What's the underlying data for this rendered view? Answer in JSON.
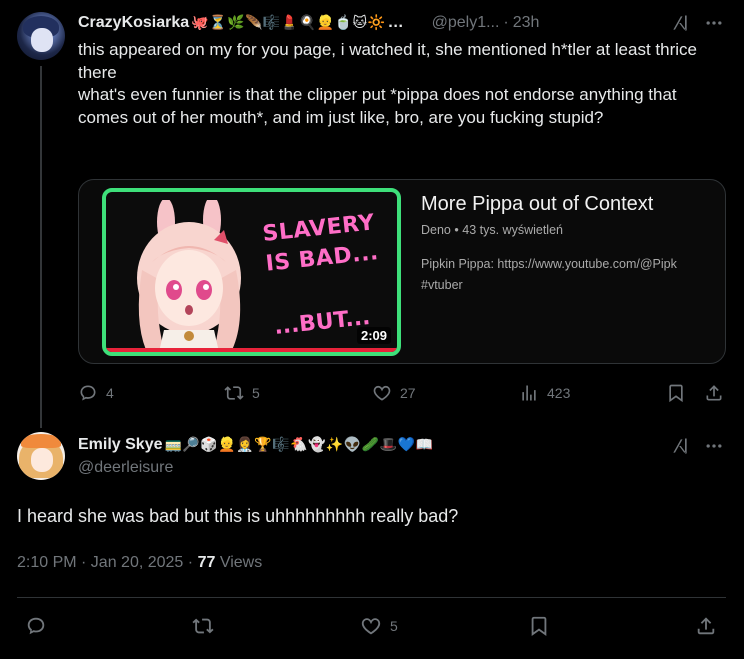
{
  "reply": {
    "author_name": "CrazyKosiarka",
    "author_emojis": "🐙⏳🌿🪶🎼💄🍳👱🍵🐱🔆",
    "ellipsis": "…",
    "handle": "@pely1...",
    "separator": "·",
    "time": "23h",
    "text_lines": [
      "this appeared on my for you page, i watched it, she mentioned h*tler at least thrice there",
      "what's even funnier is that the clipper put *pippa does not endorse anything that comes out of her mouth*, and im just like, bro, are you fucking stupid?"
    ],
    "video": {
      "title": "More Pippa out of Context",
      "channel": "Deno",
      "meta_sep": "•",
      "views": "43 tys. wyświetleń",
      "description_line1": "Pipkin Pippa: https://www.youtube.com/@Pipk",
      "description_line2": "#vtuber",
      "thumb_text_top": "SLAVERY\nIS BAD...",
      "thumb_text_bottom": "...BUT...",
      "duration": "2:09",
      "accent_border": "#3ee07a",
      "accent_text": "#ff6ec7"
    },
    "actions": {
      "replies": "4",
      "reposts": "5",
      "likes": "27",
      "views": "423"
    },
    "icons": [
      "grok-icon",
      "more-icon",
      "reply-icon",
      "repost-icon",
      "like-icon",
      "views-icon",
      "bookmark-icon",
      "share-icon"
    ]
  },
  "main": {
    "author_name": "Emily Skye",
    "author_emojis": "🚃🔎🎲👱👩‍⚕️🏆🎼🐔👻✨👽🥒🎩💙📖",
    "handle": "@deerleisure",
    "text": "I heard she was bad but this is uhhhhhhhhh really bad?",
    "timestamp": "2:10 PM · Jan 20, 2025 ·",
    "views_count": "77",
    "views_label": "Views",
    "actions": {
      "likes": "5"
    }
  },
  "colors": {
    "background": "#000000",
    "text": "#e7e9ea",
    "secondary": "#71767b",
    "border": "#2f3336"
  }
}
